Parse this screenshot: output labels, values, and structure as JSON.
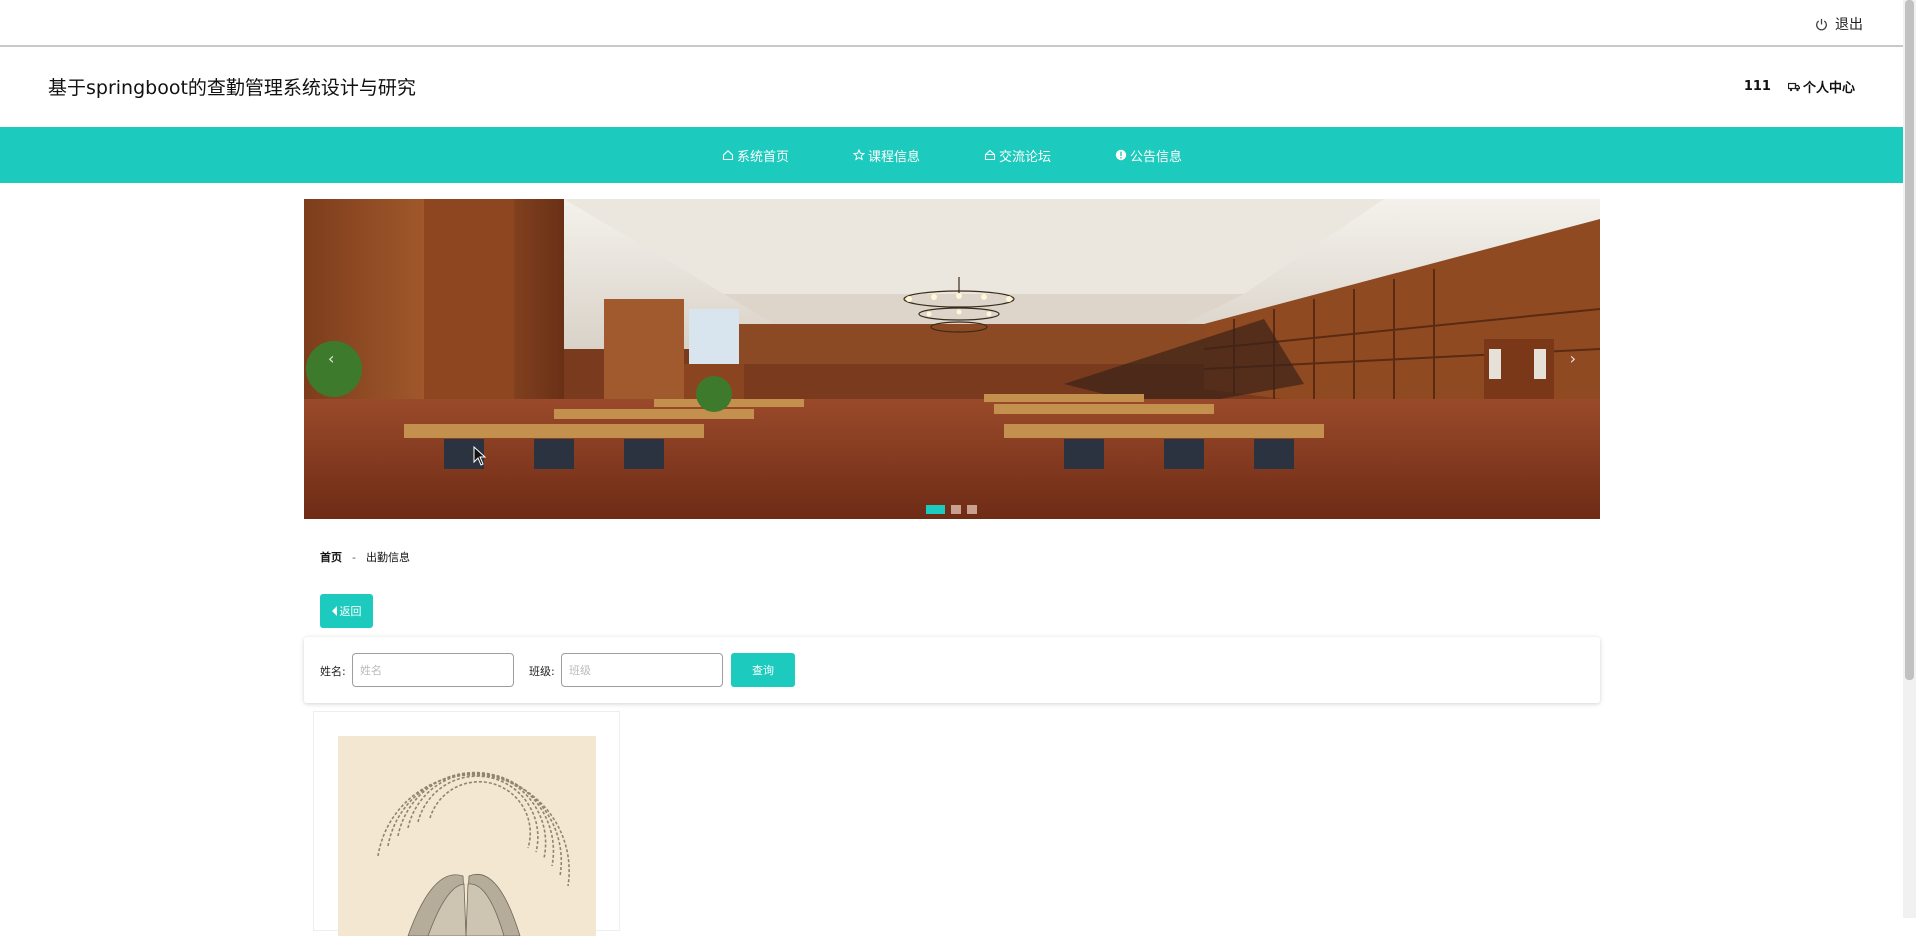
{
  "topbar": {
    "logout_label": "退出",
    "logout_icon": "power-icon"
  },
  "header": {
    "title": "基于springboot的查勤管理系统设计与研究",
    "username": "111",
    "center_label": "个人中心",
    "center_icon": "car-icon"
  },
  "nav": {
    "items": [
      {
        "label": "系统首页",
        "icon": "home-icon"
      },
      {
        "label": "课程信息",
        "icon": "star-icon"
      },
      {
        "label": "交流论坛",
        "icon": "forum-icon"
      },
      {
        "label": "公告信息",
        "icon": "info-icon"
      }
    ],
    "color": "#1ccbbe"
  },
  "carousel": {
    "prev": "‹",
    "next": "›",
    "slide_count": 3,
    "active_index": 0,
    "image": "library-reading-room"
  },
  "breadcrumb": {
    "home": "首页",
    "separator": "-",
    "current": "出勤信息"
  },
  "back_button": {
    "label": "返回"
  },
  "search": {
    "name_label": "姓名:",
    "name_placeholder": "姓名",
    "class_label": "班级:",
    "class_placeholder": "班级",
    "query_label": "查询"
  },
  "card": {
    "image": "book-with-text-arc"
  }
}
